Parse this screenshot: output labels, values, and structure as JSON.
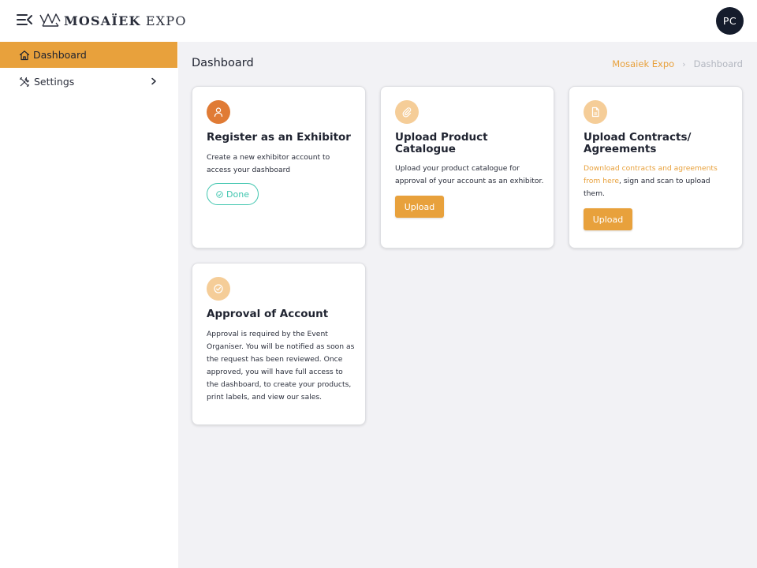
{
  "brand": {
    "name_part1": "MOSAÏEK",
    "name_part2": " EXPO"
  },
  "user": {
    "initials": "PC"
  },
  "sidebar": {
    "items": [
      {
        "label": "Dashboard",
        "icon": "home-icon"
      },
      {
        "label": "Settings",
        "icon": "tools-icon"
      }
    ]
  },
  "page": {
    "title": "Dashboard"
  },
  "breadcrumb": {
    "root": "Mosaiek Expo",
    "current": "Dashboard",
    "separator": "›"
  },
  "cards": {
    "register": {
      "icon": "user-icon",
      "title": "Register as an Exhibitor",
      "text": "Create a new exhibitor account to access your dashboard",
      "status": "Done"
    },
    "catalogue": {
      "icon": "paperclip-icon",
      "title": "Upload Product Catalogue",
      "text": "Upload your product catalogue for approval of your account as an exhibitor.",
      "button": "Upload"
    },
    "contracts": {
      "icon": "document-icon",
      "title": "Upload Contracts/ Agreements",
      "link": "Download contracts and agreements from here",
      "text": ", sign and scan to upload them.",
      "button": "Upload"
    },
    "approval": {
      "icon": "check-circle-icon",
      "title": "Approval of Account",
      "text": "Approval is required by the Event Organiser. You will be notified as soon as the request has been reviewed. Once approved, you will have full access to the dashboard, to create your products, print labels, and view our sales."
    }
  },
  "colors": {
    "accent": "#e8a13c",
    "accent_dark": "#e07b35",
    "accent_light": "#f5cd98",
    "success": "#3ec5ae",
    "avatar_bg": "#151c2c"
  }
}
